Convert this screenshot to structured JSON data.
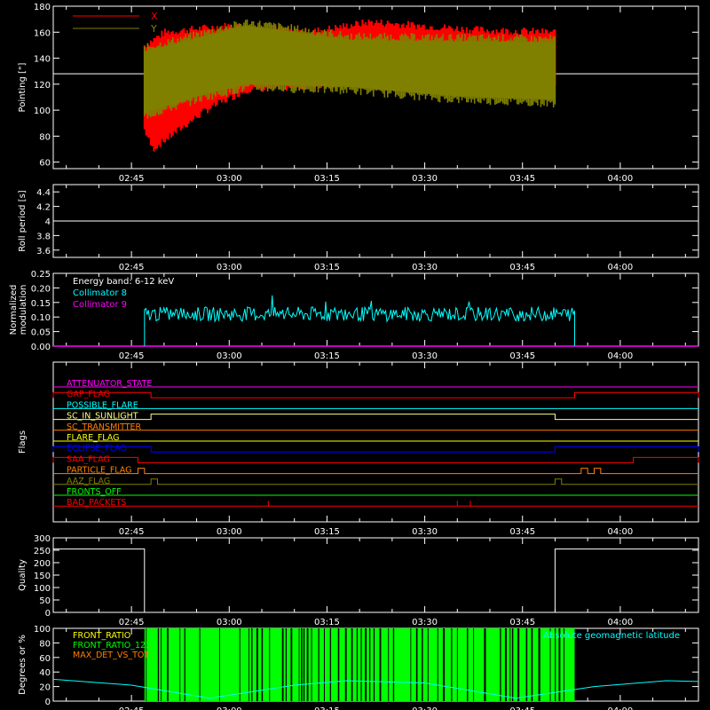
{
  "chart_data": [
    {
      "type": "line",
      "ylabel": "Pointing [\"]",
      "ylim": [
        55,
        180
      ],
      "yticks": [
        60,
        80,
        100,
        120,
        140,
        160,
        180
      ],
      "xticks": [
        "02:45",
        "03:00",
        "03:15",
        "03:30",
        "03:45",
        "04:00"
      ],
      "legend": [
        {
          "name": "X",
          "color": "#ff0000"
        },
        {
          "name": "Y",
          "color": "#808000"
        }
      ],
      "series": [
        {
          "name": "X",
          "color": "#ff0000",
          "start": "02:47",
          "end": "03:50",
          "upper": [
            [
              0,
              150
            ],
            [
              0.05,
              160
            ],
            [
              0.2,
              165
            ],
            [
              0.4,
              160
            ],
            [
              0.55,
              168
            ],
            [
              0.8,
              162
            ],
            [
              1,
              160
            ]
          ],
          "lower": [
            [
              0,
              85
            ],
            [
              0.02,
              70
            ],
            [
              0.15,
              100
            ],
            [
              0.25,
              116
            ],
            [
              0.5,
              120
            ],
            [
              0.75,
              117
            ],
            [
              1,
              118
            ]
          ]
        },
        {
          "name": "Y",
          "color": "#808000",
          "start": "02:47",
          "end": "03:50",
          "upper": [
            [
              0,
              148
            ],
            [
              0.25,
              168
            ],
            [
              0.5,
              157
            ],
            [
              0.75,
              156
            ],
            [
              1,
              155
            ]
          ],
          "lower": [
            [
              0,
              95
            ],
            [
              0.15,
              110
            ],
            [
              0.25,
              117
            ],
            [
              0.5,
              115
            ],
            [
              0.75,
              108
            ],
            [
              1,
              105
            ]
          ]
        }
      ],
      "baseline": 128
    },
    {
      "type": "line",
      "ylabel": "Roll period [s]",
      "ylim": [
        3.5,
        4.5
      ],
      "yticks": [
        3.6,
        3.8,
        4.0,
        4.2,
        4.4
      ],
      "xticks": [
        "02:45",
        "03:00",
        "03:15",
        "03:30",
        "03:45",
        "04:00"
      ],
      "value": 4.0
    },
    {
      "type": "line",
      "ylabel": "Normalized modulation",
      "ylim": [
        0,
        0.25
      ],
      "yticks": [
        "0.00",
        "0.05",
        "0.10",
        "0.15",
        "0.20",
        "0.25"
      ],
      "xticks": [
        "02:45",
        "03:00",
        "03:15",
        "03:30",
        "03:45",
        "04:00"
      ],
      "annotation": "Energy band: 6-12 keV",
      "legend": [
        {
          "name": "Collimator 8",
          "color": "#00ffff"
        },
        {
          "name": "Collimator 9",
          "color": "#ff00ff"
        }
      ],
      "series": [
        {
          "name": "Collimator 8",
          "color": "#00ffff",
          "start": "02:47",
          "end": "03:53",
          "mean": 0.11,
          "spread": 0.025
        },
        {
          "name": "Collimator 9",
          "color": "#ff00ff",
          "value": 0.0
        }
      ]
    },
    {
      "type": "line",
      "ylabel": "Flags",
      "xticks": [
        "02:45",
        "03:00",
        "03:15",
        "03:30",
        "03:45",
        "04:00"
      ],
      "flags": [
        {
          "name": "ATTENUATOR_STATE",
          "color": "#ff00ff",
          "segments": []
        },
        {
          "name": "SAA_FLAG_GAP",
          "label": "GAP_FLAG",
          "color": "#ff0000",
          "segments": [
            [
              "02:33",
              "02:48",
              1
            ],
            [
              "03:53",
              "04:12",
              1
            ]
          ]
        },
        {
          "name": "POSSIBLE_FLARE",
          "color": "#00ffff",
          "segments": []
        },
        {
          "name": "SC_IN_SUNLIGHT",
          "color": "#ffff80",
          "segments": [
            [
              "02:48",
              "03:50",
              1
            ]
          ]
        },
        {
          "name": "SC_TRANSMITTER",
          "color": "#ff8000",
          "segments": []
        },
        {
          "name": "FLARE_FLAG",
          "color": "#ffff00",
          "segments": []
        },
        {
          "name": "ECLIPSE_FLAG",
          "color": "#0000ff",
          "segments": [
            [
              "02:33",
              "02:48",
              1
            ],
            [
              "03:50",
              "04:12",
              1
            ]
          ]
        },
        {
          "name": "SAA_FLAG",
          "color": "#ff0000",
          "segments": [
            [
              "02:33",
              "02:46",
              1
            ],
            [
              "04:02",
              "04:12",
              1
            ]
          ]
        },
        {
          "name": "PARTICLE_FLAG",
          "color": "#ff8000",
          "segments": [
            [
              "02:46",
              "02:47",
              1
            ],
            [
              "03:54",
              "03:55",
              1
            ],
            [
              "03:56",
              "03:57",
              1
            ]
          ]
        },
        {
          "name": "AAZ_FLAG",
          "color": "#808000",
          "segments": [
            [
              "02:48",
              "02:49",
              1
            ],
            [
              "03:50",
              "03:51",
              1
            ]
          ]
        },
        {
          "name": "FRONTS_OFF",
          "color": "#00ff00",
          "segments": []
        },
        {
          "name": "BAD_PACKETS",
          "color": "#ff0000",
          "spikes": [
            "03:06",
            "03:35",
            "03:37"
          ]
        }
      ]
    },
    {
      "type": "line",
      "ylabel": "Quality",
      "ylim": [
        0,
        300
      ],
      "yticks": [
        0,
        50,
        100,
        150,
        200,
        250,
        300
      ],
      "xticks": [
        "02:45",
        "03:00",
        "03:15",
        "03:30",
        "03:45",
        "04:00"
      ],
      "series": [
        {
          "name": "Quality",
          "color": "#ffffff",
          "points": [
            [
              "02:33",
              255
            ],
            [
              "02:47",
              255
            ],
            [
              "02:47",
              0
            ],
            [
              "03:50",
              0
            ],
            [
              "03:50",
              255
            ],
            [
              "04:12",
              255
            ]
          ]
        }
      ]
    },
    {
      "type": "area",
      "ylabel": "Degrees or %",
      "ylim": [
        0,
        100
      ],
      "yticks": [
        0,
        20,
        40,
        60,
        80,
        100
      ],
      "xticks": [
        "02:45",
        "03:00",
        "03:15",
        "03:30",
        "03:45",
        "04:00"
      ],
      "legend": [
        {
          "name": "FRONT_RATIO",
          "color": "#ffff00"
        },
        {
          "name": "FRONT_RATIO_1225",
          "color": "#00ff00"
        },
        {
          "name": "MAX_DET_VS_TOT",
          "color": "#ff8000"
        }
      ],
      "annotation": "Absolute geomagnetic latitude",
      "annotation_color": "#00ffff",
      "bars": {
        "start": "02:47",
        "end": "03:53",
        "color": "#00ff00"
      },
      "latitude": [
        [
          "02:33",
          30
        ],
        [
          "02:45",
          22
        ],
        [
          "02:57",
          4
        ],
        [
          "03:10",
          22
        ],
        [
          "03:18",
          28
        ],
        [
          "03:30",
          25
        ],
        [
          "03:44",
          4
        ],
        [
          "03:56",
          20
        ],
        [
          "04:07",
          28
        ],
        [
          "04:12",
          27
        ]
      ]
    }
  ]
}
